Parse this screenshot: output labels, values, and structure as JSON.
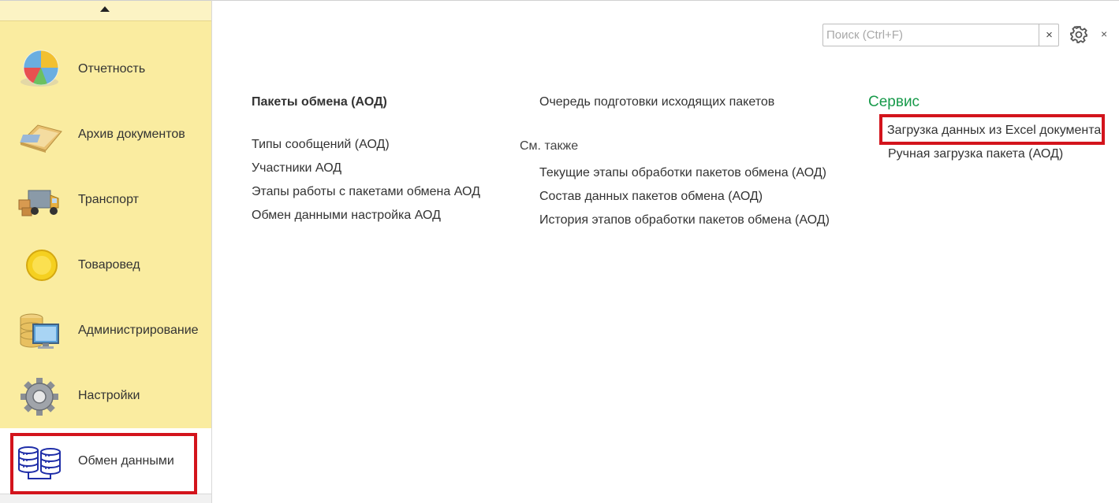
{
  "sidebar": {
    "items": [
      {
        "label": "Отчетность",
        "icon": "pie-chart-icon"
      },
      {
        "label": "Архив документов",
        "icon": "folder-archive-icon"
      },
      {
        "label": "Транспорт",
        "icon": "truck-icon"
      },
      {
        "label": "Товаровед",
        "icon": "yellow-circle-icon"
      },
      {
        "label": "Администрирование",
        "icon": "database-monitor-icon"
      },
      {
        "label": "Настройки",
        "icon": "cog-icon"
      },
      {
        "label": "Обмен данными",
        "icon": "data-exchange-icon",
        "active": true
      }
    ]
  },
  "search": {
    "placeholder": "Поиск (Ctrl+F)",
    "value": "",
    "clear": "×"
  },
  "window": {
    "close": "×"
  },
  "columns": {
    "col1": {
      "header": "Пакеты обмена (АОД)",
      "items": [
        "Типы сообщений (АОД)",
        "Участники АОД",
        "Этапы работы с пакетами обмена АОД",
        "Обмен данными настройка АОД"
      ]
    },
    "col2": {
      "top_item": "Очередь подготовки исходящих пакетов",
      "see_also_label": "См. также",
      "see_also_items": [
        "Текущие этапы обработки пакетов обмена (АОД)",
        "Состав данных пакетов обмена (АОД)",
        "История этапов обработки пакетов обмена (АОД)"
      ]
    },
    "col3": {
      "heading": "Сервис",
      "items": [
        "Загрузка данных из Excel документа",
        "Ручная загрузка пакета (АОД)"
      ]
    }
  },
  "colors": {
    "sidebar": "#faeca0",
    "section_heading": "#179a4a",
    "highlight": "#d3141c"
  }
}
